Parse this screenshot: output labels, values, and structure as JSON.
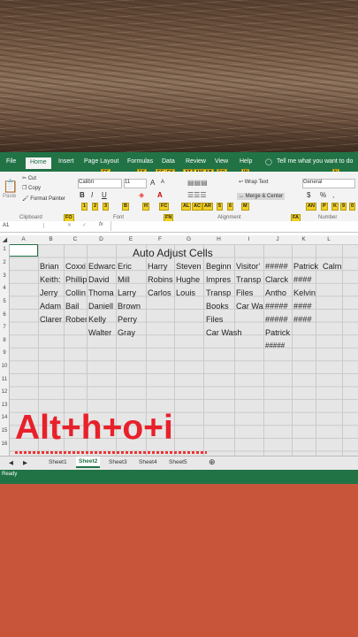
{
  "ribbon_tabs": [
    "File",
    "Home",
    "Insert",
    "Page Layout",
    "Formulas",
    "Data",
    "Review",
    "View",
    "Help",
    "Tell me what you want to do"
  ],
  "keytips_top": [
    "FF",
    "FS",
    "FG",
    "FK",
    "AT",
    "AM",
    "AB",
    "FQ",
    "W",
    "N"
  ],
  "keytips_bottom": [
    "1",
    "2",
    "3",
    "B",
    "H",
    "FC",
    "AL",
    "AC",
    "AR",
    "5",
    "6",
    "M",
    "AN",
    "P",
    "K",
    "9",
    "0"
  ],
  "keytips_groups": [
    "FO",
    "FN",
    "FA"
  ],
  "clipboard": {
    "paste": "Paste",
    "cut": "Cut",
    "copy": "Copy",
    "format_painter": "Format Painter",
    "group": "Clipboard"
  },
  "font": {
    "name": "Calibri",
    "size": "11",
    "bold": "B",
    "italic": "I",
    "underline": "U",
    "grow": "A",
    "shrink": "A",
    "group": "Font"
  },
  "alignment": {
    "wrap": "Wrap Text",
    "merge": "Merge & Center",
    "group": "Alignment"
  },
  "number": {
    "format": "General",
    "pct": "%",
    "comma": ",",
    "group": "Number"
  },
  "formula_bar": {
    "name_box": "A1",
    "fx": "fx"
  },
  "columns": [
    "A",
    "B",
    "C",
    "D",
    "E",
    "F",
    "G",
    "H",
    "I",
    "J",
    "K",
    "L"
  ],
  "rows": [
    "1",
    "2",
    "3",
    "4",
    "5",
    "6",
    "7",
    "8",
    "9",
    "10",
    "11",
    "12",
    "13",
    "14",
    "15",
    "16",
    "17",
    "18",
    "19"
  ],
  "sheet_title": "Auto Adjust Cells",
  "cells": {
    "r2": [
      "Brian",
      "Coxxi",
      "Edwarc",
      "Eric",
      "Harry",
      "Steven",
      "Beginn",
      "Visitor'",
      "#####",
      "Patrick",
      "Calm"
    ],
    "r3": [
      "Keith:",
      "Phillip",
      "David",
      "Mill",
      "Robins",
      "Hughe",
      "Impres",
      "Transp",
      "Clarck",
      "####"
    ],
    "r4": [
      "Jerry",
      "Collin",
      "Thoma",
      "Larry",
      "Carlos",
      "Louis",
      "Transp",
      "Files",
      "Antho",
      "Kelvin"
    ],
    "r5": [
      "Adam",
      "Bail",
      "Daniell",
      "Brown",
      "Books",
      "Car Wa",
      "#####",
      "####"
    ],
    "r6": [
      "Clarer",
      "Rober",
      "Kelly",
      "Perry",
      "Files",
      "#####",
      "####"
    ],
    "r7": [
      "Walter",
      "Gray",
      "Car Wash",
      "Patrick"
    ],
    "r8": [
      "#####"
    ]
  },
  "overlay_text": "Alt+h+o+i",
  "sheets": [
    "Sheet1",
    "Sheet2",
    "Sheet3",
    "Sheet4",
    "Sheet5"
  ],
  "active_sheet": "Sheet2",
  "status_text": "Ready",
  "colors": {
    "excel_green": "#217346",
    "keytip": "#f2d022",
    "shortcut_red": "#e8202a",
    "background": "#c8553a"
  }
}
